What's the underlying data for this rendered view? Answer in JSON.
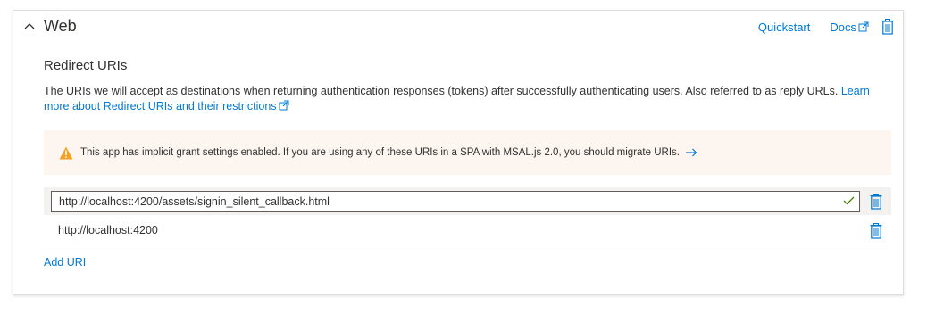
{
  "platform": {
    "title": "Web",
    "quickstart_label": "Quickstart",
    "docs_label": "Docs"
  },
  "redirect": {
    "section_title": "Redirect URIs",
    "description": "The URIs we will accept as destinations when returning authentication responses (tokens) after successfully authenticating users. Also referred to as reply URLs.",
    "learn_more_part1": "Learn",
    "learn_more_part2": "more about Redirect URIs and their restrictions",
    "warning_text": "This app has implicit grant settings enabled. If you are using any of these URIs in a SPA with MSAL.js 2.0, you should migrate URIs.",
    "uris": [
      "http://localhost:4200/assets/signin_silent_callback.html",
      "http://localhost:4200"
    ],
    "add_uri_label": "Add URI"
  },
  "colors": {
    "accent": "#0078d4",
    "warning": "#f7a122",
    "success": "#498205",
    "warning_bg": "#fdf6f0"
  },
  "icons": [
    "chevron-up-icon",
    "external-link-icon",
    "trash-icon",
    "warning-icon",
    "arrow-right-icon",
    "checkmark-icon"
  ]
}
